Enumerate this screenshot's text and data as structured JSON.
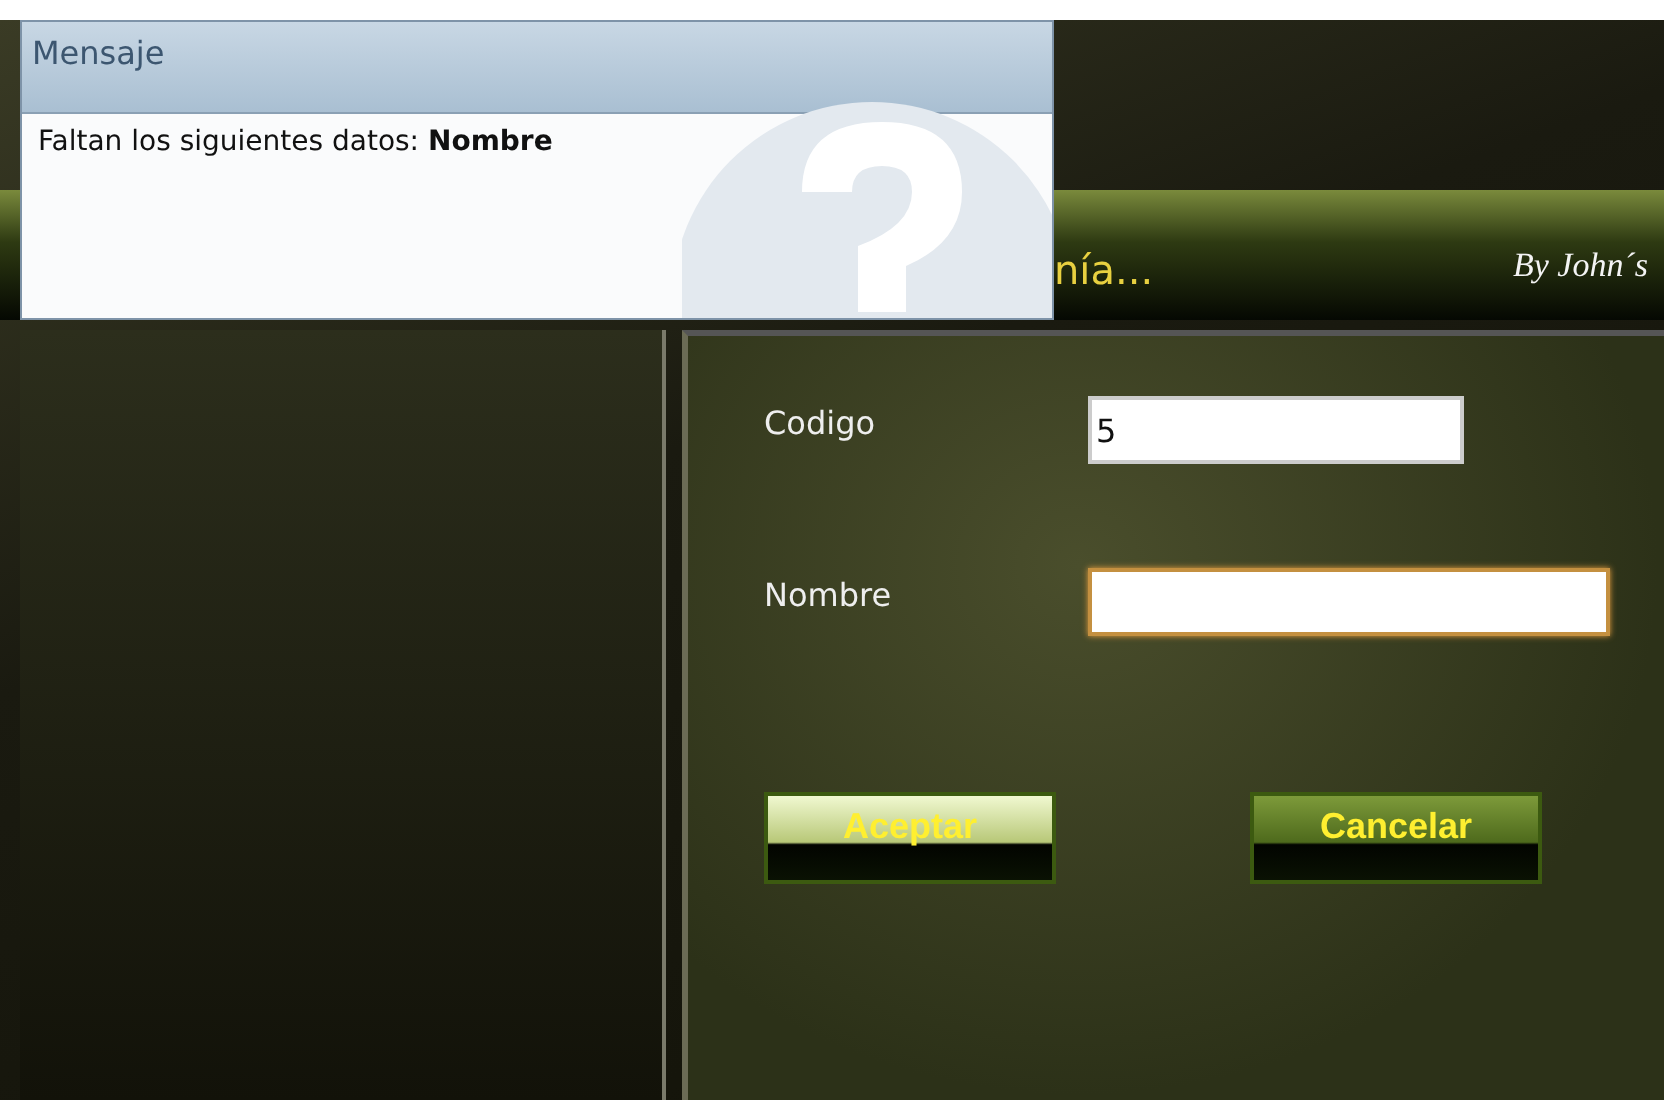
{
  "dialog": {
    "title": "Mensaje",
    "message": "Faltan los siguientes datos: **Nombre**"
  },
  "header": {
    "title": "nía...",
    "credit": "By John´s"
  },
  "form": {
    "fields": [
      {
        "label": "Codigo",
        "value": "5",
        "focused": false,
        "wide": false
      },
      {
        "label": "Nombre",
        "focused": true,
        "wide": true
      }
    ],
    "buttons": [
      {
        "label": "Aceptar",
        "selected": true
      },
      {
        "label": "Cancelar",
        "selected": false
      }
    ]
  }
}
